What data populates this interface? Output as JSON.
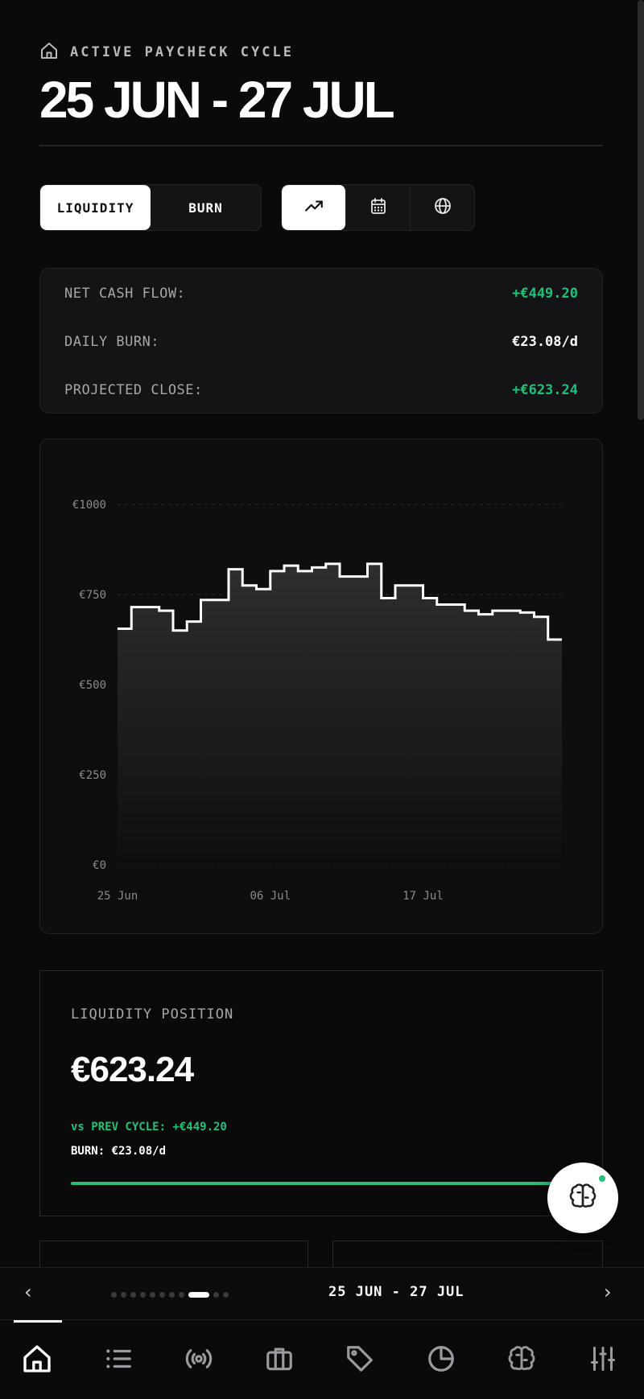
{
  "header": {
    "eyebrow": "ACTIVE PAYCHECK CYCLE",
    "title": "25 JUN - 27 JUL"
  },
  "mode_toggle": {
    "options": [
      "LIQUIDITY",
      "BURN"
    ],
    "selected": "LIQUIDITY"
  },
  "view_toggle": {
    "options": [
      "trend-icon",
      "calendar-icon",
      "globe-icon"
    ],
    "selected": "trend-icon"
  },
  "stats": [
    {
      "label": "NET CASH FLOW:",
      "value": "+€449.20",
      "color": "#22c07a"
    },
    {
      "label": "DAILY BURN:",
      "value": "€23.08/d",
      "color": "#ffffff"
    },
    {
      "label": "PROJECTED CLOSE:",
      "value": "+€623.24",
      "color": "#22c07a"
    }
  ],
  "chart_data": {
    "type": "area",
    "step": true,
    "y_ticks": [
      "€1000",
      "€750",
      "€500",
      "€250",
      "€0"
    ],
    "x_ticks": [
      "25 Jun",
      "06 Jul",
      "17 Jul"
    ],
    "ylim": [
      0,
      1000
    ],
    "x": [
      "25 Jun",
      "26 Jun",
      "27 Jun",
      "28 Jun",
      "29 Jun",
      "30 Jun",
      "01 Jul",
      "02 Jul",
      "03 Jul",
      "04 Jul",
      "05 Jul",
      "06 Jul",
      "07 Jul",
      "08 Jul",
      "09 Jul",
      "10 Jul",
      "11 Jul",
      "12 Jul",
      "13 Jul",
      "14 Jul",
      "15 Jul",
      "16 Jul",
      "17 Jul",
      "18 Jul",
      "19 Jul",
      "20 Jul",
      "21 Jul",
      "22 Jul",
      "23 Jul",
      "24 Jul",
      "25 Jul",
      "26 Jul",
      "27 Jul"
    ],
    "values": [
      655,
      715,
      715,
      705,
      650,
      675,
      735,
      735,
      820,
      775,
      765,
      815,
      830,
      815,
      825,
      835,
      800,
      800,
      835,
      740,
      775,
      775,
      740,
      722,
      722,
      705,
      695,
      705,
      705,
      700,
      688,
      625,
      625
    ],
    "grid": true,
    "line_color": "#ffffff"
  },
  "liquidity": {
    "label": "LIQUIDITY POSITION",
    "value": "€623.24",
    "vs_prev": "vs PREV CYCLE: +€449.20",
    "burn": "BURN: €23.08/d",
    "accent": "#22c07a"
  },
  "cycle_nav": {
    "label": "25 JUN - 27 JUL",
    "dot_count": 11,
    "active_dot": 8
  },
  "tabbar": {
    "items": [
      "home-icon",
      "list-icon",
      "broadcast-icon",
      "briefcase-icon",
      "tag-icon",
      "pie-chart-icon",
      "brain-icon",
      "sliders-icon"
    ],
    "active": "home-icon"
  }
}
